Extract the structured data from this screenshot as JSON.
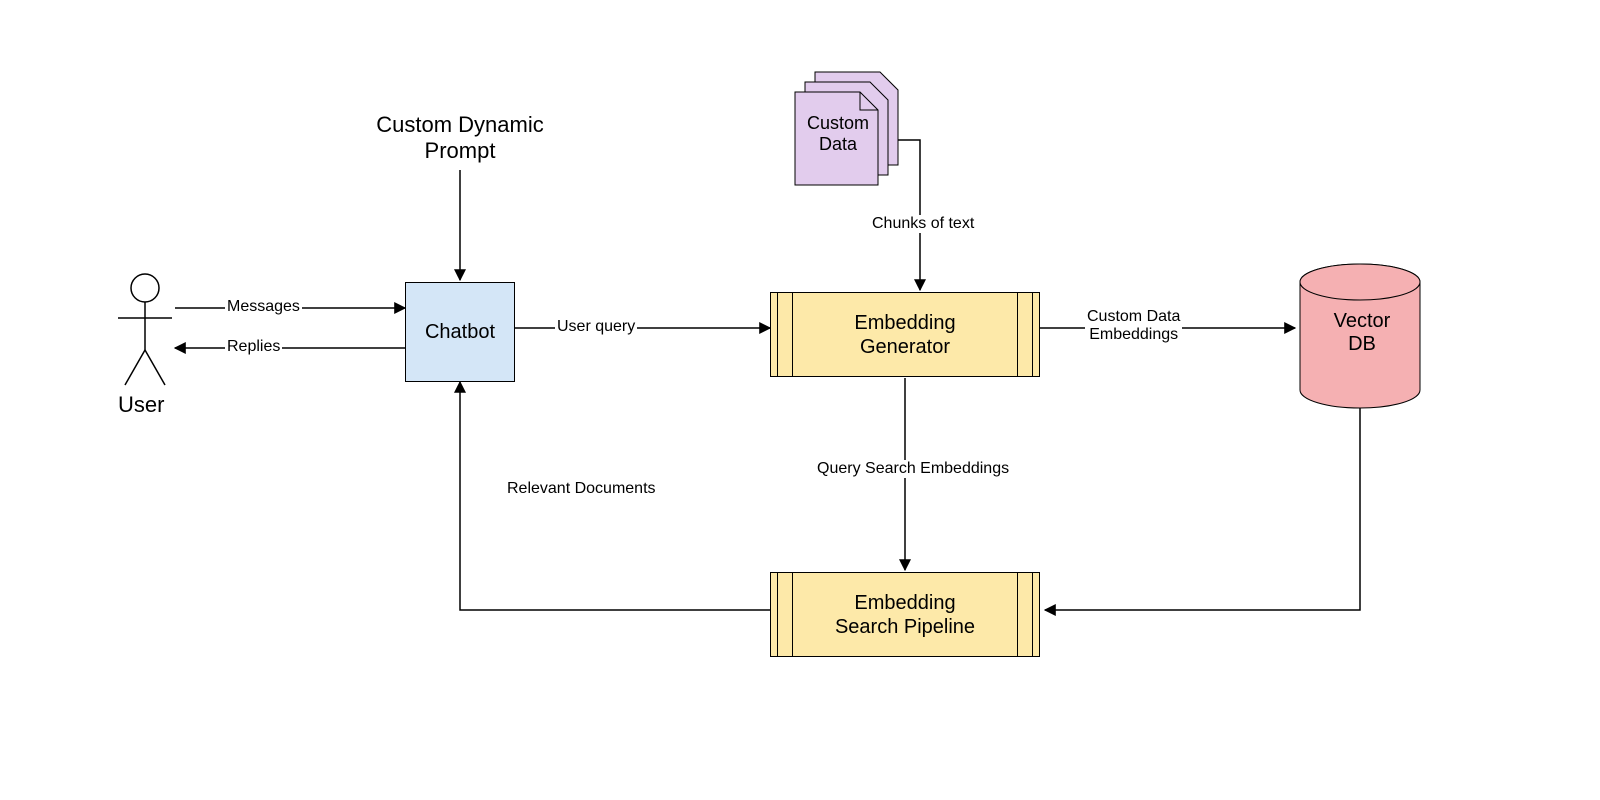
{
  "nodes": {
    "user": "User",
    "chatbot": "Chatbot",
    "prompt": "Custom Dynamic\nPrompt",
    "custom_data": "Custom\nData",
    "embed_gen": "Embedding\nGenerator",
    "vector_db": "Vector\nDB",
    "embed_search": "Embedding\nSearch Pipeline"
  },
  "edges": {
    "messages": "Messages",
    "replies": "Replies",
    "user_query": "User query",
    "chunks": "Chunks of text",
    "custom_embeddings": "Custom Data\nEmbeddings",
    "query_embeddings": "Query Search Embeddings",
    "relevant_docs": "Relevant Documents"
  },
  "colors": {
    "chatbot_fill": "#d4e6f7",
    "module_fill": "#fde9a9",
    "data_fill": "#e2cced",
    "db_fill": "#f5b0b2",
    "stroke": "#000000"
  }
}
